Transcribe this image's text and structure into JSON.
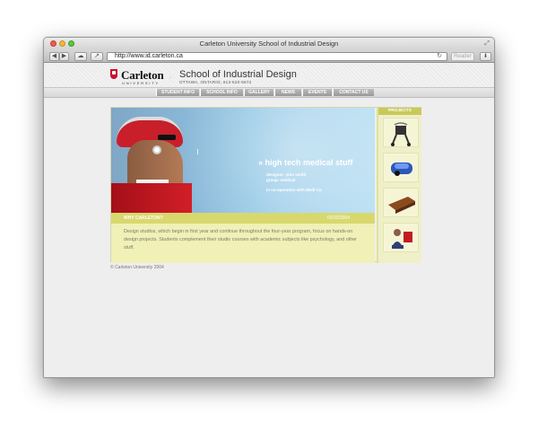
{
  "browser": {
    "window_title": "Carleton University School of Industrial Design",
    "url": "http://www.id.carleton.ca",
    "reader_label": "Reader"
  },
  "site": {
    "brand": "Carleton",
    "brand_sub": "UNIVERSITY",
    "title": "School of Industrial Design",
    "address": "OTTAWA, ONTARIO, 613-520-5672"
  },
  "nav": [
    "STUDENT INFO",
    "SCHOOL INFO",
    "GALLERY",
    "NEWS",
    "EVENTS",
    "CONTACT US"
  ],
  "hero": {
    "title": "» high tech medical stuff",
    "designer": "designer: john smith",
    "group": "group: medical",
    "cooperation": "in co-operation with Medi Co."
  },
  "panel": {
    "label": "WHY CARLETON?",
    "date": "02/23/2004",
    "text": "Design studios, which begin in first year and continue throughout the four-year program, focus on hands-on design projects.  Students complement their studio courses with academic subjects like psychology, and other stuff."
  },
  "projects": {
    "label": "PROJECTS"
  },
  "footer": {
    "copyright": "© Carleton University 2004"
  }
}
